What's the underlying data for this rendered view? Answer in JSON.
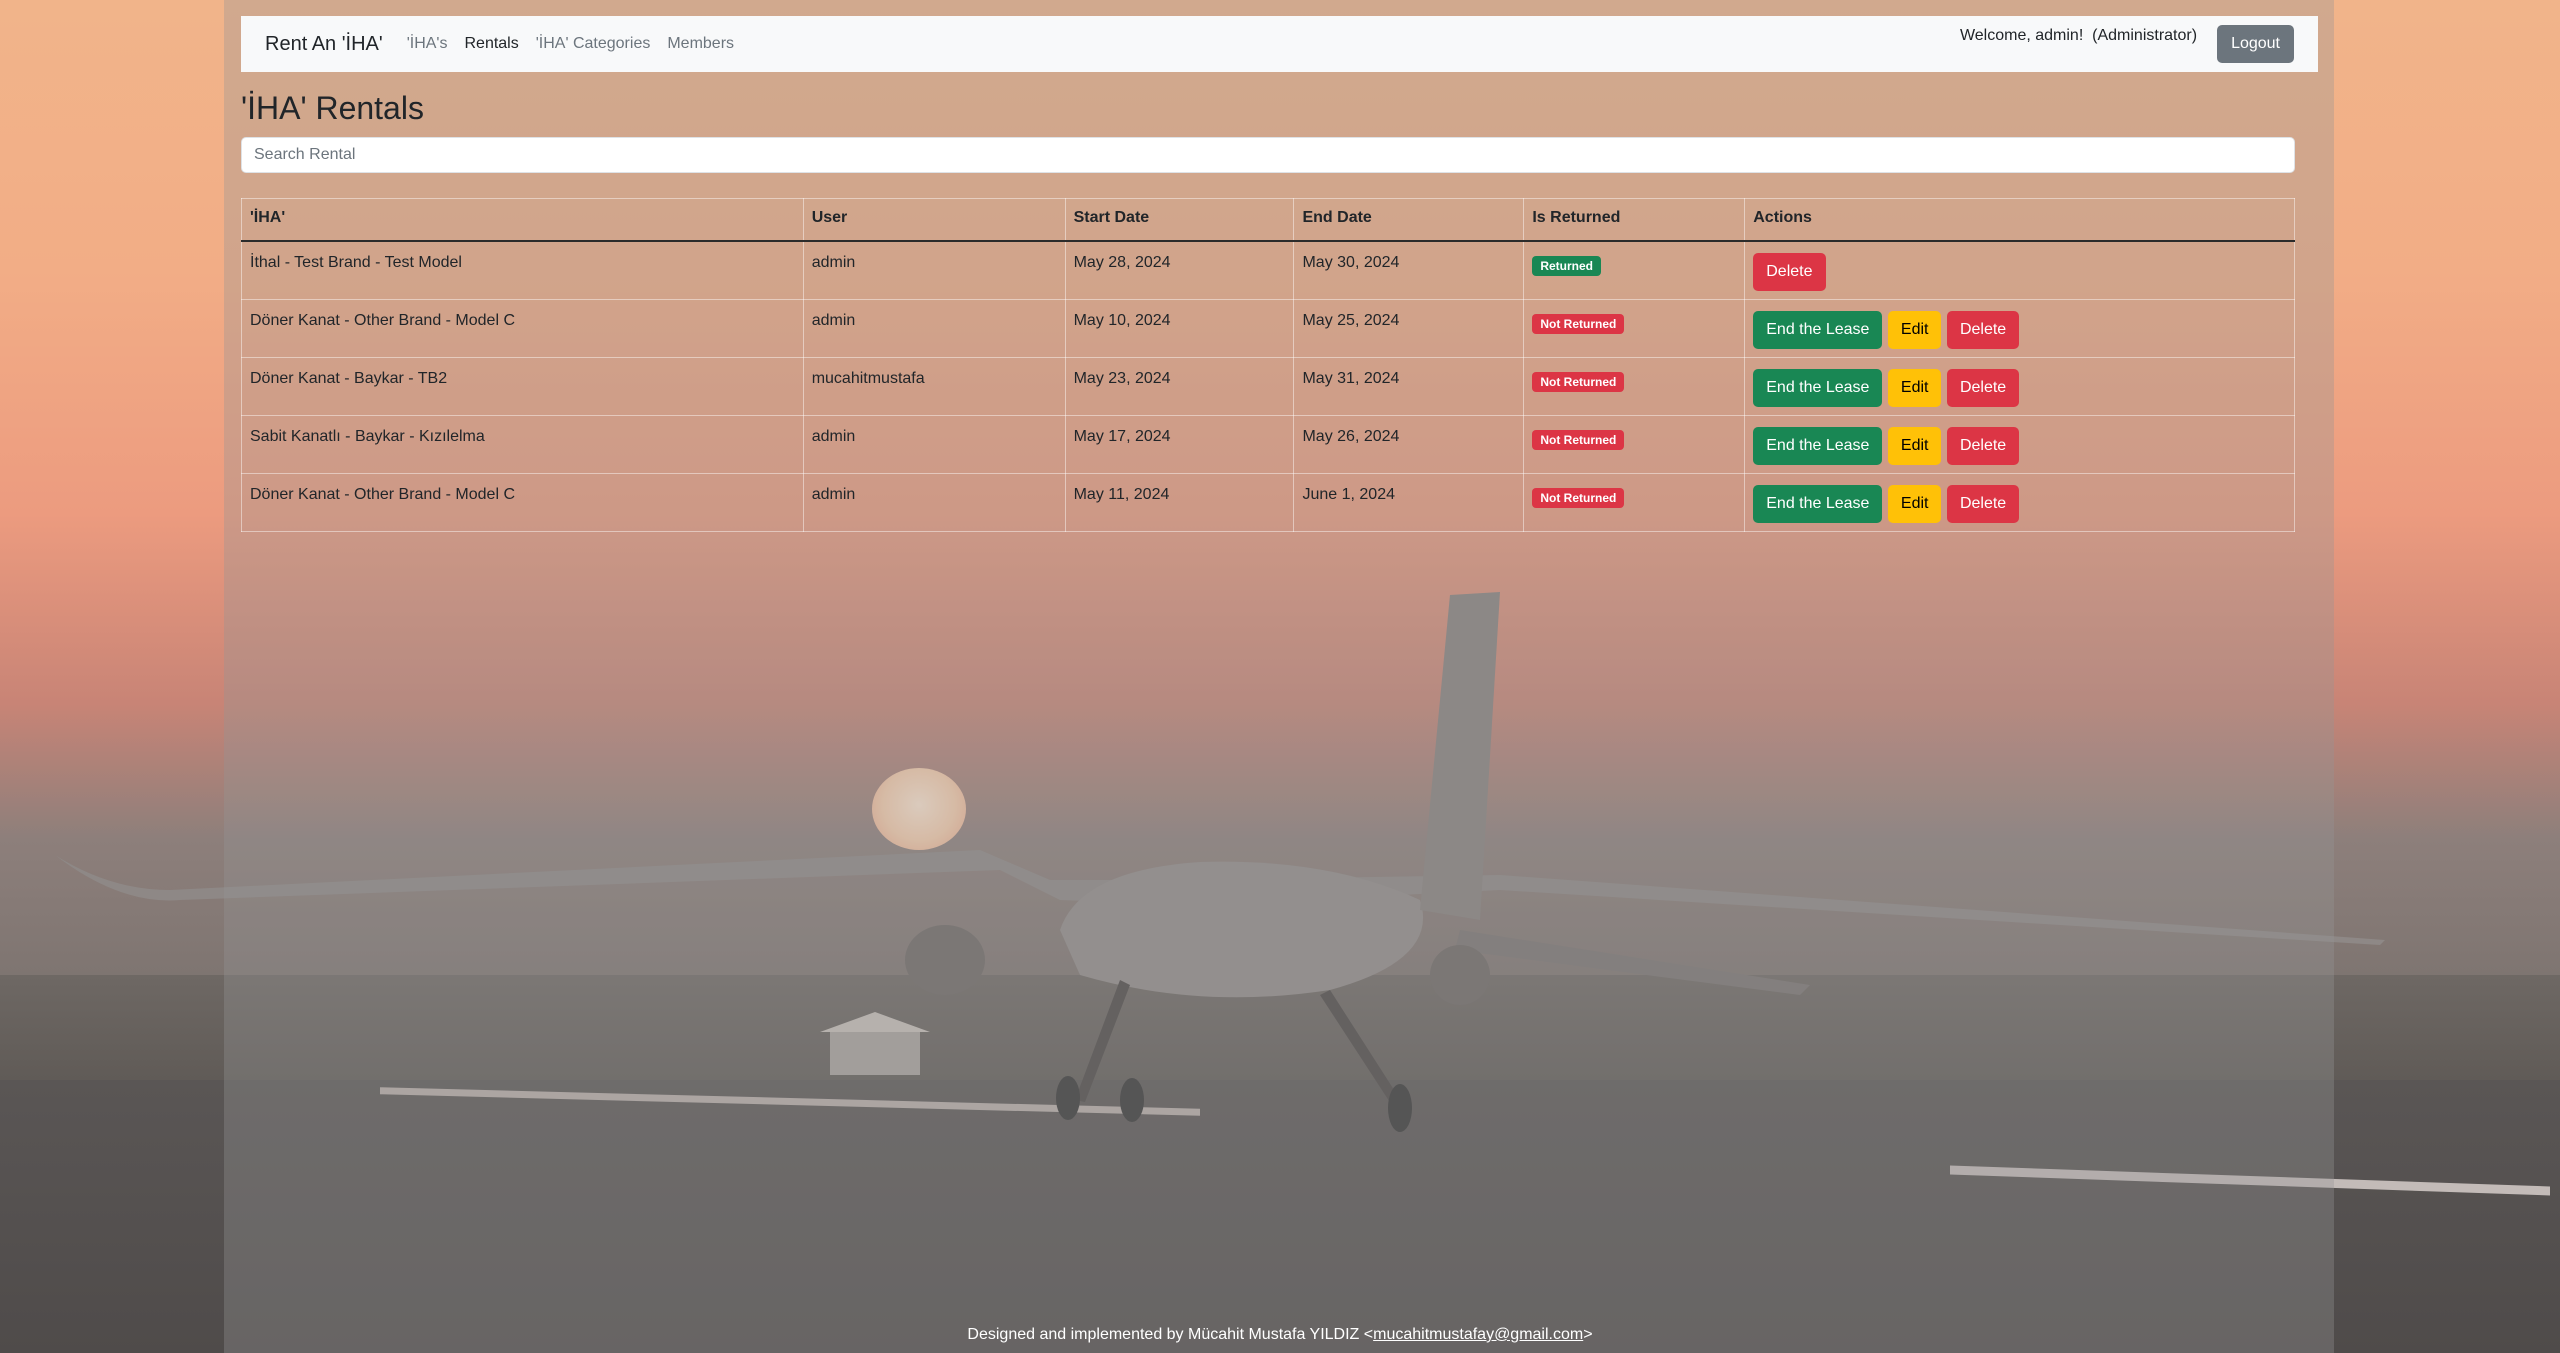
{
  "app": {
    "brand": "Rent An 'İHA'"
  },
  "nav": {
    "links": [
      {
        "label": "'İHA's"
      },
      {
        "label": "Rentals"
      },
      {
        "label": "'İHA' Categories"
      },
      {
        "label": "Members"
      }
    ],
    "welcome": "Welcome, admin!  (Administrator)",
    "logout_label": "Logout"
  },
  "page": {
    "title": "'İHA' Rentals",
    "search_placeholder": "Search Rental"
  },
  "table": {
    "headers": [
      "'İHA'",
      "User",
      "Start Date",
      "End Date",
      "Is Returned",
      "Actions"
    ],
    "rows": [
      {
        "iha": "İthal - Test Brand - Test Model",
        "user": "admin",
        "start": "May 28, 2024",
        "end": "May 30, 2024",
        "status": "Returned",
        "end_lease": "",
        "edit": "",
        "delete": "Delete"
      },
      {
        "iha": "Döner Kanat - Other Brand - Model C",
        "user": "admin",
        "start": "May 10, 2024",
        "end": "May 25, 2024",
        "status": "Not Returned",
        "end_lease": "End the Lease",
        "edit": "Edit",
        "delete": "Delete"
      },
      {
        "iha": "Döner Kanat - Baykar - TB2",
        "user": "mucahitmustafa",
        "start": "May 23, 2024",
        "end": "May 31, 2024",
        "status": "Not Returned",
        "end_lease": "End the Lease",
        "edit": "Edit",
        "delete": "Delete"
      },
      {
        "iha": "Sabit Kanatlı - Baykar - Kızılelma",
        "user": "admin",
        "start": "May 17, 2024",
        "end": "May 26, 2024",
        "status": "Not Returned",
        "end_lease": "End the Lease",
        "edit": "Edit",
        "delete": "Delete"
      },
      {
        "iha": "Döner Kanat - Other Brand - Model C",
        "user": "admin",
        "start": "May 11, 2024",
        "end": "June 1, 2024",
        "status": "Not Returned",
        "end_lease": "End the Lease",
        "edit": "Edit",
        "delete": "Delete"
      }
    ]
  },
  "footer": {
    "text": "Designed and implemented by Mücahit Mustafa YILDIZ <",
    "email": "mucahitmustafay@gmail.com",
    "suffix": ">"
  },
  "colors": {
    "success": "#198754",
    "warning": "#ffc107",
    "danger": "#dc3545",
    "secondary": "#6c757d"
  }
}
